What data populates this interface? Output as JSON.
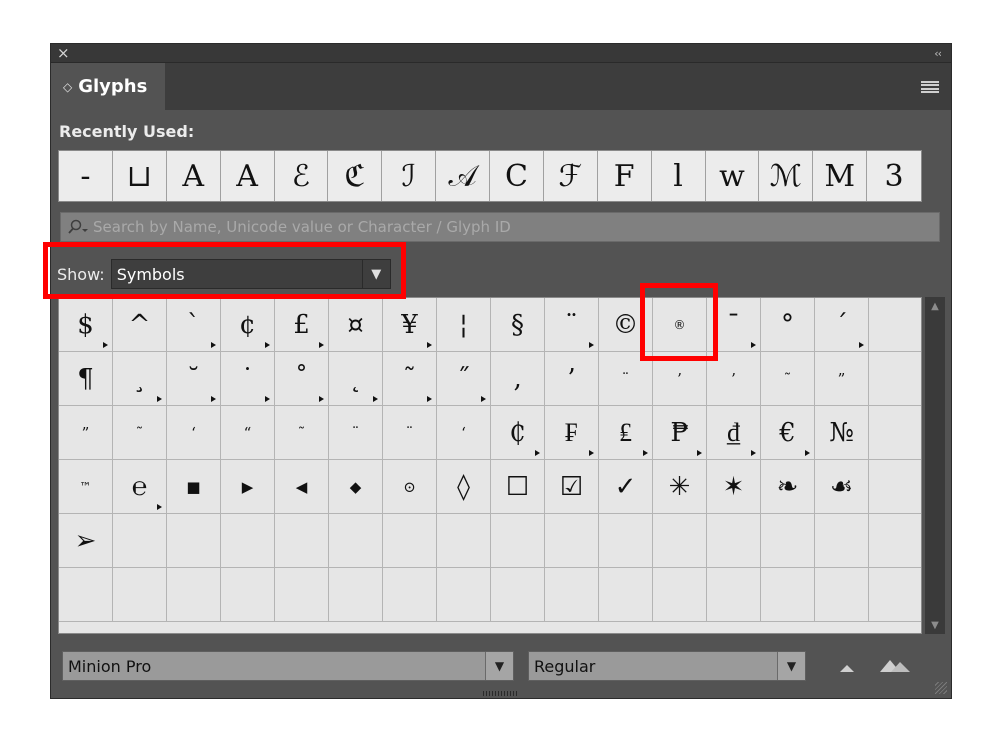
{
  "panel": {
    "title": "Glyphs",
    "recently_used_label": "Recently Used:",
    "search_placeholder": "Search by Name, Unicode value or Character / Glyph ID",
    "show_label": "Show:",
    "show_value": "Symbols",
    "font_family": "Minion Pro",
    "font_style": "Regular",
    "highlight_color": "#ff0000"
  },
  "recent": [
    "-",
    "⊔",
    "A",
    "A",
    "ℰ",
    "ℭ",
    "ℐ",
    "𝒜",
    "C",
    "ℱ",
    "F",
    "l",
    "w",
    "ℳ",
    "M",
    "3"
  ],
  "glyphs": [
    {
      "ch": "$",
      "tri": true
    },
    {
      "ch": "^",
      "tri": false
    },
    {
      "ch": "`",
      "tri": true
    },
    {
      "ch": "¢",
      "tri": true
    },
    {
      "ch": "£",
      "tri": true
    },
    {
      "ch": "¤",
      "tri": false
    },
    {
      "ch": "¥",
      "tri": true
    },
    {
      "ch": "¦",
      "tri": false
    },
    {
      "ch": "§",
      "tri": false
    },
    {
      "ch": "¨",
      "tri": true
    },
    {
      "ch": "©",
      "tri": false
    },
    {
      "ch": "®",
      "tri": false,
      "size": "tiny"
    },
    {
      "ch": "¯",
      "tri": true
    },
    {
      "ch": "°",
      "tri": false
    },
    {
      "ch": "´",
      "tri": true
    },
    {
      "ch": "",
      "tri": false
    },
    {
      "ch": "¶",
      "tri": false
    },
    {
      "ch": "¸",
      "tri": true
    },
    {
      "ch": "˘",
      "tri": true
    },
    {
      "ch": "˙",
      "tri": true
    },
    {
      "ch": "˚",
      "tri": true
    },
    {
      "ch": "˛",
      "tri": true
    },
    {
      "ch": "˜",
      "tri": true
    },
    {
      "ch": "˝",
      "tri": true
    },
    {
      "ch": "‚",
      "tri": false
    },
    {
      "ch": "’",
      "tri": false
    },
    {
      "ch": "¨",
      "tri": false,
      "size": "small"
    },
    {
      "ch": "’",
      "tri": false,
      "size": "small"
    },
    {
      "ch": "’",
      "tri": false,
      "size": "small"
    },
    {
      "ch": "˜",
      "tri": false,
      "size": "small"
    },
    {
      "ch": "”",
      "tri": false,
      "size": "small"
    },
    {
      "ch": "",
      "tri": false
    },
    {
      "ch": "”",
      "tri": false,
      "size": "small"
    },
    {
      "ch": "˜",
      "tri": false,
      "size": "small"
    },
    {
      "ch": "‘",
      "tri": false,
      "size": "small"
    },
    {
      "ch": "“",
      "tri": false,
      "size": "small"
    },
    {
      "ch": "˜",
      "tri": false,
      "size": "small"
    },
    {
      "ch": "¨",
      "tri": false,
      "size": "small"
    },
    {
      "ch": "¨",
      "tri": false,
      "size": "small"
    },
    {
      "ch": "ʻ",
      "tri": false,
      "size": "small"
    },
    {
      "ch": "₵",
      "tri": true
    },
    {
      "ch": "₣",
      "tri": true
    },
    {
      "ch": "₤",
      "tri": true
    },
    {
      "ch": "₱",
      "tri": true
    },
    {
      "ch": "₫",
      "tri": true
    },
    {
      "ch": "€",
      "tri": true
    },
    {
      "ch": "№",
      "tri": false
    },
    {
      "ch": "",
      "tri": false
    },
    {
      "ch": "™",
      "tri": false,
      "size": "tiny"
    },
    {
      "ch": "℮",
      "tri": true
    },
    {
      "ch": "■",
      "tri": false,
      "size": "small"
    },
    {
      "ch": "▶",
      "tri": false,
      "size": "small"
    },
    {
      "ch": "◀",
      "tri": false,
      "size": "small"
    },
    {
      "ch": "◆",
      "tri": false,
      "size": "small"
    },
    {
      "ch": "⊙",
      "tri": false,
      "size": "small"
    },
    {
      "ch": "◊",
      "tri": false
    },
    {
      "ch": "☐",
      "tri": false
    },
    {
      "ch": "☑",
      "tri": false
    },
    {
      "ch": "✓",
      "tri": false
    },
    {
      "ch": "✳",
      "tri": false
    },
    {
      "ch": "✶",
      "tri": false
    },
    {
      "ch": "❧",
      "tri": false
    },
    {
      "ch": "☙",
      "tri": false
    },
    {
      "ch": "",
      "tri": false
    },
    {
      "ch": "➢",
      "tri": false
    },
    {
      "ch": "",
      "tri": false
    },
    {
      "ch": "",
      "tri": false
    },
    {
      "ch": "",
      "tri": false
    },
    {
      "ch": "",
      "tri": false
    },
    {
      "ch": "",
      "tri": false
    },
    {
      "ch": "",
      "tri": false
    },
    {
      "ch": "",
      "tri": false
    },
    {
      "ch": "",
      "tri": false
    },
    {
      "ch": "",
      "tri": false
    },
    {
      "ch": "",
      "tri": false
    },
    {
      "ch": "",
      "tri": false
    },
    {
      "ch": "",
      "tri": false
    },
    {
      "ch": "",
      "tri": false
    },
    {
      "ch": "",
      "tri": false
    },
    {
      "ch": "",
      "tri": false
    },
    {
      "ch": "",
      "tri": false
    },
    {
      "ch": "",
      "tri": false
    },
    {
      "ch": "",
      "tri": false
    },
    {
      "ch": "",
      "tri": false
    },
    {
      "ch": "",
      "tri": false
    },
    {
      "ch": "",
      "tri": false
    },
    {
      "ch": "",
      "tri": false
    },
    {
      "ch": "",
      "tri": false
    },
    {
      "ch": "",
      "tri": false
    },
    {
      "ch": "",
      "tri": false
    },
    {
      "ch": "",
      "tri": false
    },
    {
      "ch": "",
      "tri": false
    },
    {
      "ch": "",
      "tri": false
    },
    {
      "ch": "",
      "tri": false
    },
    {
      "ch": "",
      "tri": false
    },
    {
      "ch": "",
      "tri": false
    }
  ]
}
